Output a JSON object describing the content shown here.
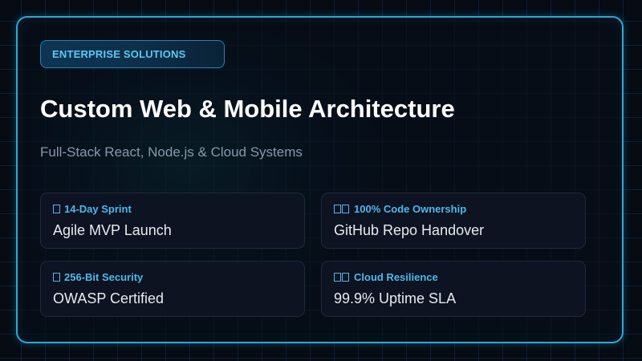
{
  "badge": {
    "label": "ENTERPRISE SOLUTIONS"
  },
  "heading": {
    "title": "Custom Web & Mobile Architecture",
    "subtitle": "Full-Stack React, Node.js & Cloud Systems"
  },
  "cards": [
    {
      "icon": "missing-glyph-icon",
      "label": "14-Day Sprint",
      "value": "Agile MVP Launch"
    },
    {
      "icon": "missing-glyph-icon",
      "label": "100% Code Ownership",
      "value": "GitHub Repo Handover"
    },
    {
      "icon": "missing-glyph-icon",
      "label": "256-Bit Security",
      "value": "OWASP Certified"
    },
    {
      "icon": "missing-glyph-icon",
      "label": "Cloud Resilience",
      "value": "99.9% Uptime SLA"
    }
  ],
  "colors": {
    "background": "#060b14",
    "frame_border": "#2aa8d8",
    "accent": "#4db8ec",
    "title": "#ffffff",
    "subtitle": "#8a97a9",
    "card_value": "#e6eaf0"
  }
}
